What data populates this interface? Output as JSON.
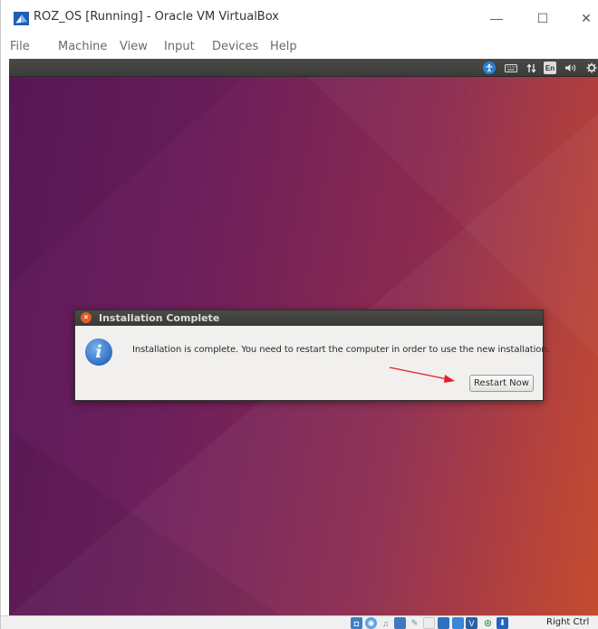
{
  "window": {
    "title": "ROZ_OS [Running] - Oracle VM VirtualBox",
    "controls": {
      "minimize": "—",
      "maximize": "☐",
      "close": "✕"
    }
  },
  "menu": {
    "items": [
      "File",
      "Machine",
      "View",
      "Input",
      "Devices",
      "Help"
    ]
  },
  "guest_panel": {
    "icons": [
      "accessibility-icon",
      "keyboard-icon",
      "network-icon",
      "language-indicator",
      "volume-icon",
      "settings-gear-icon"
    ],
    "language": "En"
  },
  "dialog": {
    "title": "Installation Complete",
    "message": "Installation is complete. You need to restart the computer in order to use the new installation.",
    "button_label": "Restart Now",
    "close_glyph": "×",
    "info_glyph": "i"
  },
  "statusbar": {
    "icons": [
      "hard-disk-icon",
      "optical-drive-icon",
      "audio-icon",
      "network-adapter-icon",
      "usb-icon",
      "shared-folders-icon",
      "display-icon",
      "capture-icon",
      "virtualization-icon",
      "mouse-integration-icon",
      "keyboard-capture-icon"
    ],
    "host_key": "Right Ctrl"
  },
  "colors": {
    "desktop_gradient_start": "#5b1a5a",
    "desktop_gradient_end": "#c24424",
    "dialog_titlebar": "#3a3a37",
    "annotation_arrow": "#e3202a",
    "info_icon": "#2d6fc4"
  }
}
